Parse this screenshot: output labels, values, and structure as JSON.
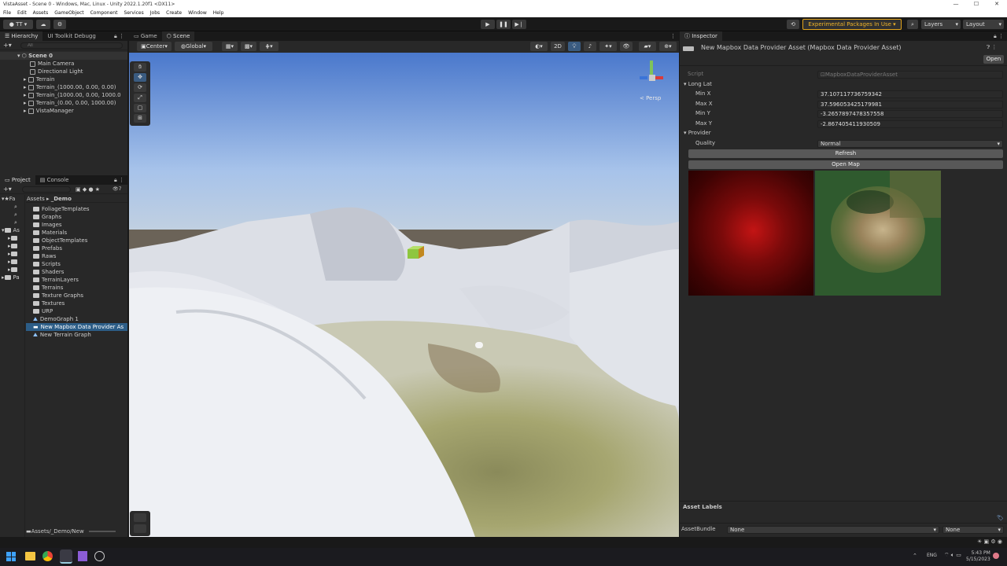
{
  "window": {
    "title": "VistaAsset - Scene 0 - Windows, Mac, Linux - Unity 2022.1.20f1 <DX11>"
  },
  "menu": [
    "File",
    "Edit",
    "Assets",
    "GameObject",
    "Component",
    "Services",
    "Jobs",
    "Create",
    "Window",
    "Help"
  ],
  "toolbar": {
    "account": "TT",
    "experimental": "Experimental Packages In Use ▾",
    "layers": "Layers",
    "layout": "Layout"
  },
  "hierarchy": {
    "tabs": [
      "Hierarchy",
      "UI Toolkit Debugg"
    ],
    "search_placeholder": "All",
    "scene": "Scene 0",
    "items": [
      "Main Camera",
      "Directional Light",
      "Terrain",
      "Terrain_(1000.00, 0.00, 0.00)",
      "Terrain_(1000.00, 0.00, 1000.0",
      "Terrain_(0.00, 0.00, 1000.00)",
      "VistaManager"
    ]
  },
  "project": {
    "tabs": [
      "Project",
      "Console"
    ],
    "breadcrumb": [
      "Assets",
      "_Demo"
    ],
    "left_labels": [
      "Fa",
      "As",
      "Pa"
    ],
    "items": [
      "FoliageTemplates",
      "Graphs",
      "Images",
      "Materials",
      "ObjectTemplates",
      "Prefabs",
      "Raws",
      "Scripts",
      "Shaders",
      "TerrainLayers",
      "Terrains",
      "Texture Graphs",
      "Textures",
      "URP",
      "DemoGraph 1",
      "New Mapbox Data Provider As",
      "New Terrain Graph"
    ],
    "status_path": "Assets/_Demo/New",
    "filter_count": "7"
  },
  "scene": {
    "tabs": [
      "Game",
      "Scene"
    ],
    "pivot": "Center",
    "space": "Global",
    "mode_2d": "2D",
    "persp": "< Persp"
  },
  "inspector": {
    "tab": "Inspector",
    "asset_title": "New Mapbox Data Provider Asset (Mapbox Data Provider Asset)",
    "open": "Open",
    "script_label": "Script",
    "script_value": "MapboxDataProviderAsset",
    "longlat": "Long Lat",
    "min_x_label": "Min X",
    "min_x": "37.107117736759342",
    "max_x_label": "Max X",
    "max_x": "37.596053425179981",
    "min_y_label": "Min Y",
    "min_y": "-3.2657897478357558",
    "max_y_label": "Max Y",
    "max_y": "-2.867405411930509",
    "provider": "Provider",
    "quality_label": "Quality",
    "quality": "Normal",
    "refresh": "Refresh",
    "open_map": "Open Map",
    "asset_labels": "Asset Labels",
    "asset_bundle_label": "AssetBundle",
    "asset_bundle": "None",
    "asset_variant": "None"
  },
  "taskbar": {
    "lang": "ENG",
    "time": "5:43 PM",
    "date": "5/15/2023"
  },
  "colors": {
    "selection": "#2c5d87",
    "warning": "#f0b429",
    "sky_top": "#4f7fd0",
    "sky_bottom": "#a9c6ee"
  }
}
